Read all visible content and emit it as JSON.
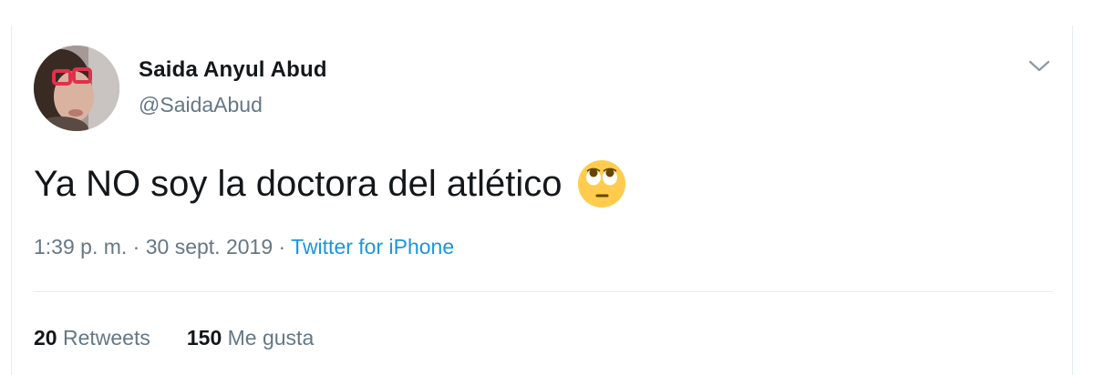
{
  "tweet": {
    "author_name": "Saida Anyul Abud",
    "author_handle": "@SaidaAbud",
    "text": "Ya NO soy la doctora del atlético",
    "emoji": "face-with-rolling-eyes-emoji",
    "time": "1:39 p. m.",
    "separator1": " · ",
    "date": "30 sept. 2019",
    "separator2": " · ",
    "source": "Twitter for iPhone",
    "retweets_count": "20",
    "retweets_label": "Retweets",
    "likes_count": "150",
    "likes_label": "Me gusta"
  },
  "colors": {
    "text": "#14171a",
    "secondary": "#657786",
    "link": "#1b95e0",
    "border": "#e6ecf0"
  },
  "icons": {
    "menu": "chevron-down-icon"
  }
}
